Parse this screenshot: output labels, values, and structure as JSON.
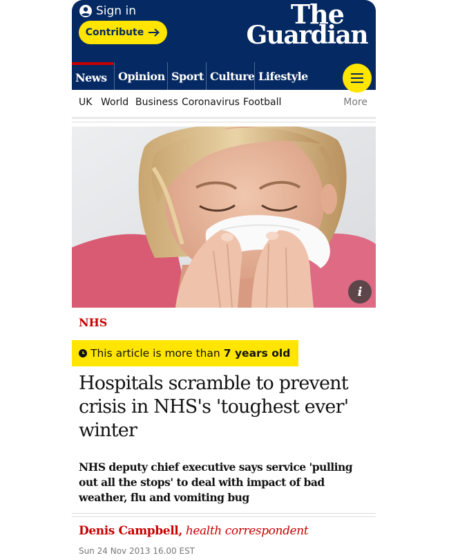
{
  "header": {
    "sign_in_label": "Sign in",
    "contribute_label": "Contribute",
    "logo_line1": "The",
    "logo_line2": "Guardian"
  },
  "nav": {
    "items": [
      {
        "label": "News",
        "active": true
      },
      {
        "label": "Opinion"
      },
      {
        "label": "Sport"
      },
      {
        "label": "Culture"
      },
      {
        "label": "Lifestyle"
      }
    ],
    "menu_icon": "hamburger-icon"
  },
  "subnav": {
    "items": [
      "UK",
      "World",
      "Business",
      "Coronavirus",
      "Football"
    ],
    "more_label": "More"
  },
  "article": {
    "image_info_glyph": "i",
    "section": "NHS",
    "age_notice_prefix": "This article is more than",
    "age_notice_value": "7 years old",
    "headline_lines": [
      "Hospitals scramble to prevent",
      "crisis in NHS's 'toughest ever'",
      "winter"
    ],
    "standfirst_lines": [
      "NHS deputy chief executive says service 'pulling",
      "out all the stops' to deal with impact of bad",
      "weather, flu and vomiting bug"
    ],
    "author_name": "Denis Campbell,",
    "author_role": "health correspondent",
    "date": "Sun 24 Nov 2013 16.00 EST"
  },
  "colors": {
    "brand_blue": "#052962",
    "brand_yellow": "#ffe500",
    "news_red": "#c70000"
  }
}
